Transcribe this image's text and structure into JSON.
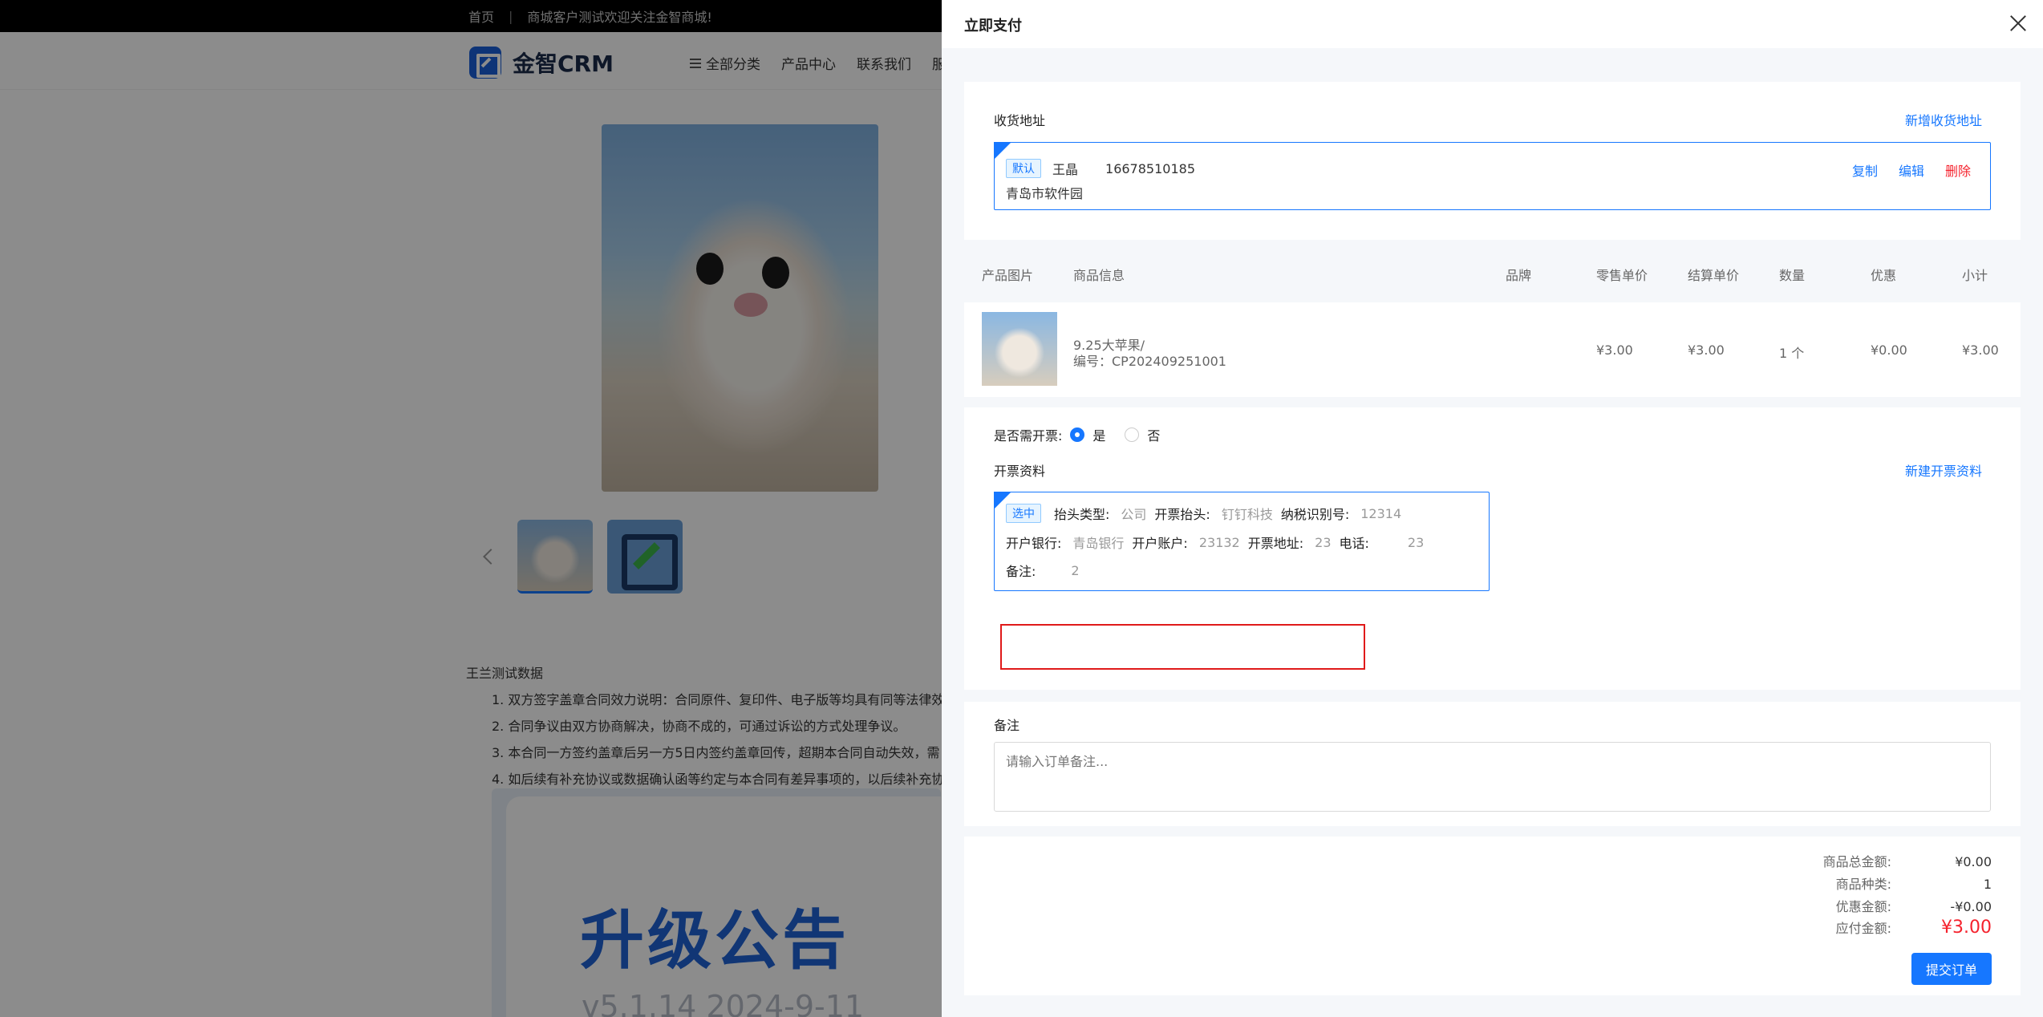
{
  "topbar": {
    "home": "首页",
    "sep": "|",
    "notice": "商城客户测试欢迎关注金智商城!"
  },
  "brand": {
    "name": "金智CRM"
  },
  "nav": {
    "all_categories": "全部分类",
    "products": "产品中心",
    "contact": "联系我们",
    "more": "服"
  },
  "description": {
    "title": "王兰测试数据",
    "items": [
      "1. 双方签字盖章合同效力说明：合同原件、复印件、电子版等均具有同等法律效",
      "2. 合同争议由双方协商解决，协商不成的，可通过诉讼的方式处理争议。",
      "3. 本合同一方签约盖章后另一方5日内签约盖章回传，超期本合同自动失效，需",
      "4. 如后续有补充协议或数据确认函等约定与本合同有差异事项的，以后续补充协"
    ]
  },
  "announcement": {
    "title": "升级公告",
    "version": "v5.1.14 2024-9-11"
  },
  "drawer": {
    "title": "立即支付",
    "address": {
      "label": "收货地址",
      "add_link": "新增收货地址",
      "default_tag": "默认",
      "name": "王晶",
      "phone": "16678510185",
      "detail": "青岛市软件园",
      "copy": "复制",
      "edit": "编辑",
      "delete": "删除"
    },
    "table": {
      "headers": [
        "产品图片",
        "商品信息",
        "品牌",
        "零售单价",
        "结算单价",
        "数量",
        "优惠",
        "小计"
      ],
      "rows": [
        {
          "name": "9.25大苹果/",
          "code": "编号：CP202409251001",
          "brand": "",
          "retail_price": "¥3.00",
          "settle_price": "¥3.00",
          "quantity": "1 个",
          "discount": "¥0.00",
          "subtotal": "¥3.00"
        }
      ]
    },
    "invoice": {
      "need_label": "是否需开票:",
      "yes": "是",
      "no": "否",
      "info_label": "开票资料",
      "new_link": "新建开票资料",
      "selected_tag": "选中",
      "header_type_k": "抬头类型:",
      "header_type_v": "公司",
      "header_k": "开票抬头:",
      "header_v": "钉钉科技",
      "tax_k": "纳税识别号:",
      "tax_v": "12314",
      "bank_k": "开户银行:",
      "bank_v": "青岛银行",
      "account_k": "开户账户:",
      "account_v": "23132",
      "address_k": "开票地址:",
      "address_v": "23",
      "tel_k": "电话:",
      "tel_v": "23",
      "remark_k": "备注:",
      "remark_v": "2"
    },
    "remark": {
      "label": "备注",
      "placeholder": "请输入订单备注..."
    },
    "summary": {
      "total_k": "商品总金额:",
      "total_v": "¥0.00",
      "kinds_k": "商品种类:",
      "kinds_v": "1",
      "discount_k": "优惠金额:",
      "discount_v": "-¥0.00",
      "payable_k": "应付金额:",
      "payable_v": "¥3.00",
      "submit": "提交订单"
    }
  },
  "colors": {
    "primary": "#1677ff",
    "danger": "#f5222d",
    "highlight_box": "#e01a1a"
  }
}
